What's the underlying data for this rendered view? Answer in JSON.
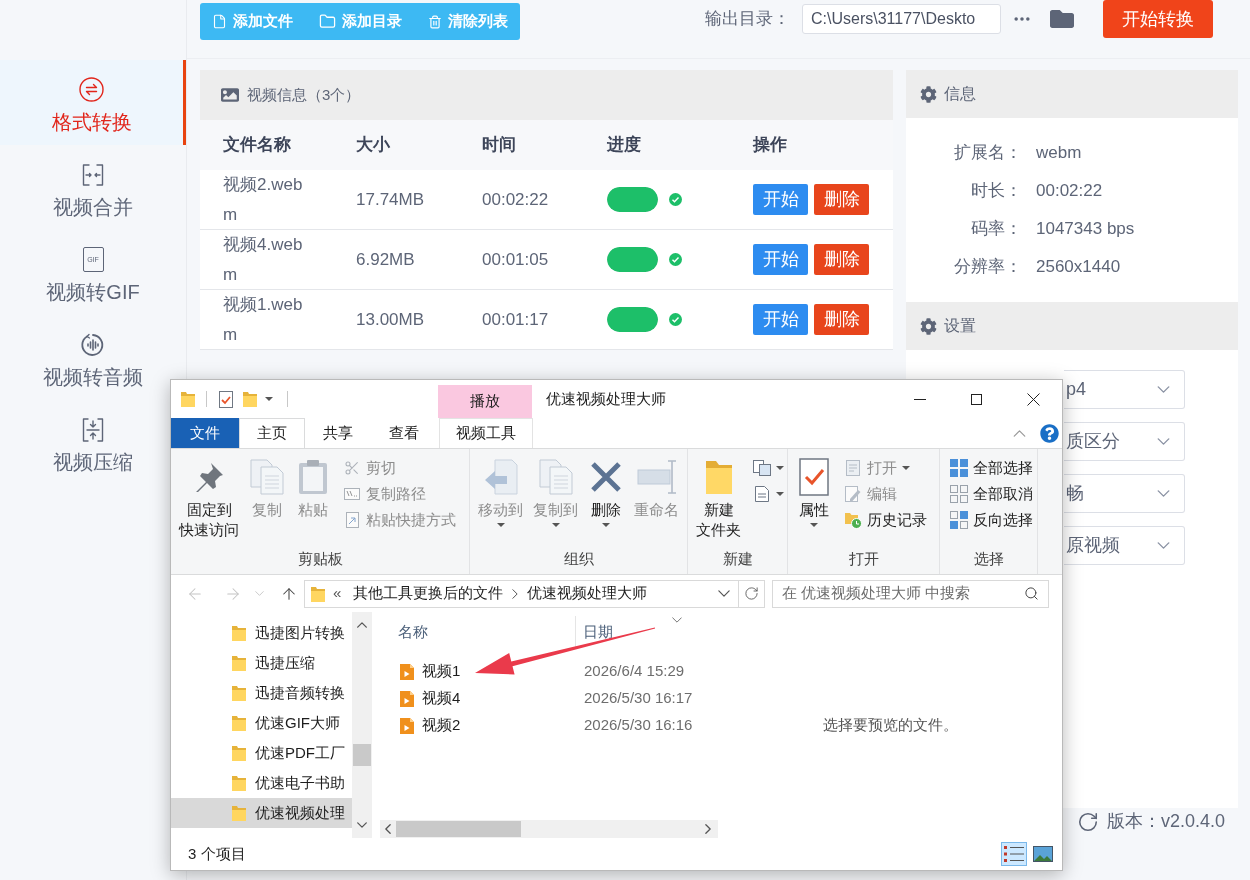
{
  "toolbar": {
    "buttons": [
      {
        "label": "添加文件",
        "kind": "file"
      },
      {
        "label": "添加目录",
        "kind": "folder"
      },
      {
        "label": "清除列表",
        "kind": "trash"
      }
    ],
    "output_label": "输出目录：",
    "output_path": "C:\\Users\\31177\\Deskto",
    "start_button": "开始转换"
  },
  "sidebar": {
    "items": [
      {
        "label": "格式转换",
        "kind": "convert",
        "selected": true
      },
      {
        "label": "视频合并",
        "kind": "merge",
        "selected": false
      },
      {
        "label": "视频转GIF",
        "kind": "gif",
        "badge": "GIF",
        "selected": false
      },
      {
        "label": "视频转音频",
        "kind": "audio",
        "selected": false
      },
      {
        "label": "视频压缩",
        "kind": "compress",
        "selected": false
      }
    ]
  },
  "video_panel": {
    "title": "视频信息（3个）",
    "columns": [
      "文件名称",
      "大小",
      "时间",
      "进度",
      "操作"
    ],
    "rows": [
      {
        "name": "视频2.webm",
        "size": "17.74MB",
        "time": "00:02:22",
        "level": 1,
        "done": true,
        "actions": [
          {
            "label": "开始",
            "kind": "start"
          },
          {
            "label": "删除",
            "kind": "delete"
          }
        ]
      },
      {
        "name": "视频4.webm",
        "size": "6.92MB",
        "time": "00:01:05",
        "level": 1,
        "done": true,
        "actions": [
          {
            "label": "开始",
            "kind": "start"
          },
          {
            "label": "删除",
            "kind": "delete"
          }
        ]
      },
      {
        "name": "视频1.webm",
        "size": "13.00MB",
        "time": "00:01:17",
        "level": 1,
        "done": true,
        "actions": [
          {
            "label": "开始",
            "kind": "start"
          },
          {
            "label": "删除",
            "kind": "delete"
          }
        ]
      }
    ]
  },
  "info_panel": {
    "title": "信息",
    "rows": [
      {
        "label": "扩展名：",
        "value": "webm"
      },
      {
        "label": "时长：",
        "value": "00:02:22"
      },
      {
        "label": "码率：",
        "value": "1047343 bps"
      },
      {
        "label": "分辨率：",
        "value": "2560x1440"
      }
    ]
  },
  "settings_panel": {
    "title": "设置",
    "selects": [
      {
        "value": "p4"
      },
      {
        "value": "质区分"
      },
      {
        "value": "畅"
      },
      {
        "value": "原视频"
      }
    ]
  },
  "version": "版本：v2.0.4.0",
  "explorer": {
    "context_group": "播放",
    "title": "优速视频处理大师",
    "tabs": [
      {
        "label": "文件",
        "kind": "file",
        "selected": false
      },
      {
        "label": "主页",
        "kind": "tab",
        "selected": true
      },
      {
        "label": "共享",
        "kind": "tab",
        "selected": false
      },
      {
        "label": "查看",
        "kind": "tab",
        "selected": false
      },
      {
        "label": "视频工具",
        "kind": "context",
        "selected": false
      }
    ],
    "ribbon": [
      {
        "label": "剪贴板",
        "large": [
          {
            "lines": [
              "固定到",
              "快速访问"
            ],
            "kind": "pin",
            "disabled": false,
            "menu": false
          },
          {
            "lines": [
              "复制"
            ],
            "kind": "copy",
            "disabled": true,
            "menu": false
          },
          {
            "lines": [
              "粘贴"
            ],
            "kind": "paste",
            "disabled": true,
            "menu": false
          }
        ],
        "small": [
          {
            "label": "剪切",
            "kind": "cut",
            "disabled": true,
            "menu": false
          },
          {
            "label": "复制路径",
            "kind": "path",
            "disabled": true,
            "menu": false
          },
          {
            "label": "粘贴快捷方式",
            "kind": "shortcut",
            "disabled": true,
            "menu": false
          }
        ]
      },
      {
        "label": "组织",
        "large": [
          {
            "lines": [
              "移动到"
            ],
            "kind": "move",
            "disabled": true,
            "menu": true
          },
          {
            "lines": [
              "复制到"
            ],
            "kind": "copyto",
            "disabled": true,
            "menu": true
          },
          {
            "lines": [
              "删除"
            ],
            "kind": "delete",
            "disabled": false,
            "menu": true
          },
          {
            "lines": [
              "重命名"
            ],
            "kind": "rename",
            "disabled": true,
            "menu": false
          }
        ]
      },
      {
        "label": "新建",
        "large": [
          {
            "lines": [
              "新建",
              "文件夹"
            ],
            "kind": "newfolder",
            "disabled": false,
            "menu": false
          }
        ],
        "small": [
          {
            "kind": "newitem",
            "disabled": false,
            "menu": true
          },
          {
            "kind": "easyaccess",
            "disabled": false,
            "menu": true
          }
        ]
      },
      {
        "label": "打开",
        "large": [
          {
            "lines": [
              "属性"
            ],
            "kind": "properties",
            "disabled": false,
            "menu": true
          }
        ],
        "small": [
          {
            "label": "打开",
            "kind": "open",
            "disabled": true,
            "menu": true
          },
          {
            "label": "编辑",
            "kind": "edit",
            "disabled": true,
            "menu": false
          },
          {
            "label": "历史记录",
            "kind": "history",
            "disabled": false,
            "menu": false
          }
        ]
      },
      {
        "label": "选择",
        "small": [
          {
            "label": "全部选择",
            "kind": "selectall",
            "disabled": false,
            "menu": false
          },
          {
            "label": "全部取消",
            "kind": "selectnone",
            "disabled": false,
            "menu": false
          },
          {
            "label": "反向选择",
            "kind": "invert",
            "disabled": false,
            "menu": false
          }
        ]
      }
    ],
    "address": {
      "overflow": "«",
      "crumbs": [
        "其他工具更换后的文件",
        "优速视频处理大师"
      ]
    },
    "search": {
      "placeholder": "在 优速视频处理大师 中搜索"
    },
    "nav": [
      {
        "label": "迅捷图片转换",
        "selected": false
      },
      {
        "label": "迅捷压缩",
        "selected": false
      },
      {
        "label": "迅捷音频转换",
        "selected": false
      },
      {
        "label": "优速GIF大师",
        "selected": false
      },
      {
        "label": "优速PDF工厂",
        "selected": false
      },
      {
        "label": "优速电子书助",
        "selected": false
      },
      {
        "label": "优速视频处理",
        "selected": true
      }
    ],
    "file_columns": [
      "名称",
      "日期"
    ],
    "files": [
      {
        "name": "视频1",
        "date": "2026/6/4 15:29"
      },
      {
        "name": "视频4",
        "date": "2026/5/30 16:17"
      },
      {
        "name": "视频2",
        "date": "2026/5/30 16:16"
      }
    ],
    "preview": "选择要预览的文件。",
    "status": "3 个项目",
    "views": [
      {
        "kind": "details",
        "selected": true
      },
      {
        "kind": "thumbnails",
        "selected": false
      }
    ]
  }
}
